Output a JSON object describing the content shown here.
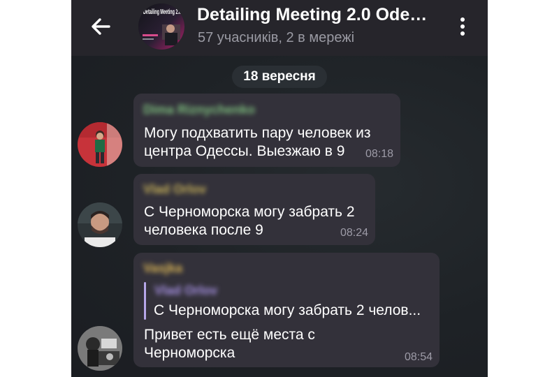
{
  "header": {
    "title": "Detailing Meeting 2.0 Ode…",
    "subtitle": "57 учасників, 2 в мережі",
    "avatar_caption": "Detailing Meeting 2.0"
  },
  "date_separator": "18 вересня",
  "messages": [
    {
      "sender": "Dima Riznychenko",
      "sender_color": "#7ec07e",
      "lines": [
        "Могу подхватить пару человек из",
        "центра Одессы. Выезжаю в 9"
      ],
      "time": "08:18"
    },
    {
      "sender": "Vlad Orlov",
      "sender_color": "#c9b35a",
      "lines": [
        "С Черноморска могу забрать 2",
        "человека после 9"
      ],
      "time": "08:24"
    },
    {
      "sender": "Vasjka",
      "sender_color": "#d8b456",
      "reply": {
        "name": "Vlad Orlov",
        "text": "С Черноморска могу забрать 2 челов..."
      },
      "lines": [
        "Привет есть ещё места с",
        "Черноморска"
      ],
      "time": "08:54"
    }
  ],
  "colors": {
    "header_bg": "#26252b",
    "bubble_bg": "#33313a",
    "reply_accent": "#b6a7e8"
  }
}
